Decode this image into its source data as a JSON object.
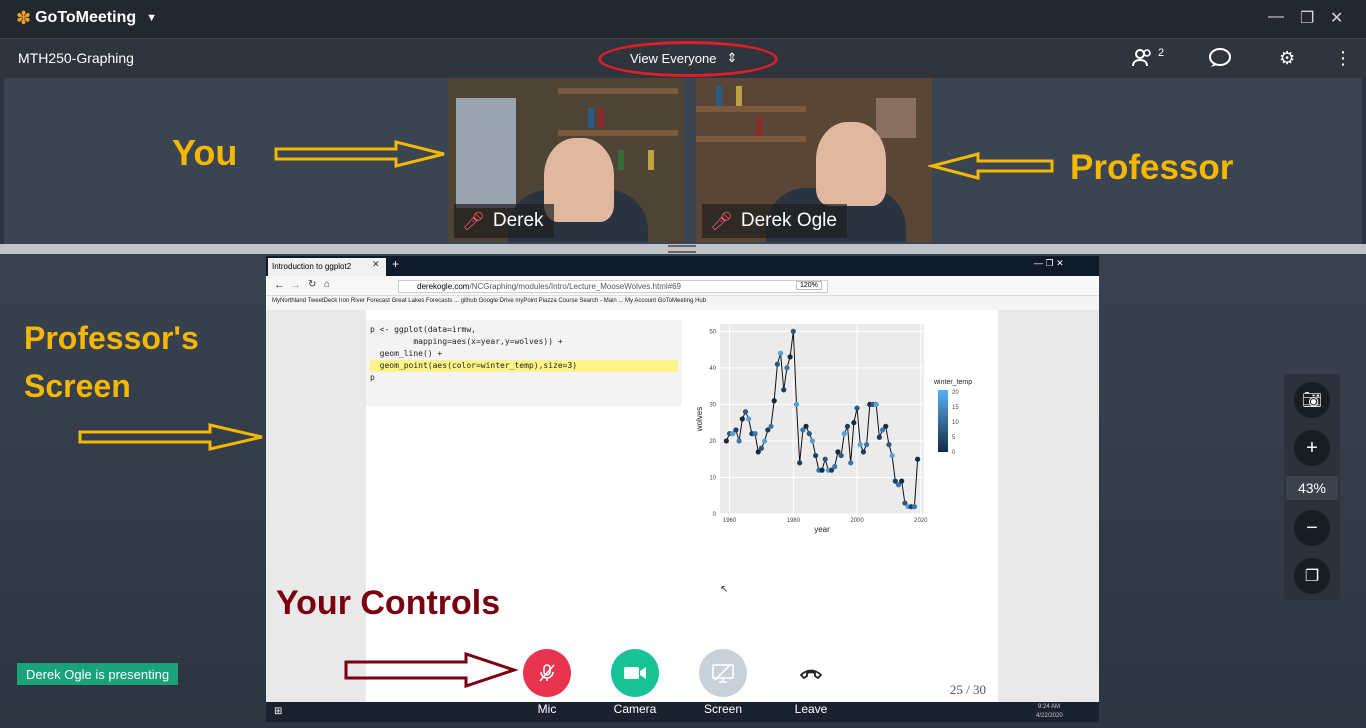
{
  "app": {
    "name": "GoToMeeting"
  },
  "window": {
    "minimize": "—",
    "restore": "❐",
    "close": "✕"
  },
  "toolbar": {
    "meeting_name": "MTH250-Graphing",
    "view_label": "View Everyone",
    "attendee_count": "2"
  },
  "participants": [
    {
      "name": "Derek",
      "annotation": "You"
    },
    {
      "name": "Derek Ogle",
      "annotation": "Professor"
    }
  ],
  "annotations": {
    "screen": "Professor's\nScreen",
    "screen_line1": "Professor's",
    "screen_line2": "Screen",
    "controls": "Your Controls"
  },
  "shared_screen": {
    "tab_title": "Introduction to ggplot2",
    "url_host": "derekogle.com",
    "url_path": "/NCGraphing/modules/Intro/Lecture_MooseWolves.html#69",
    "zoom": "120%",
    "bookmarks": "MyNorthland   TweetDeck   Iron River Forecast   Great Lakes Forecasts ...   github   Google Drive   myPoint   Piazza   Course Search - Main ...   My Account   GoToMeeting Hub",
    "code": [
      "p <- ggplot(data=irmw,",
      "         mapping=aes(x=year,y=wolves)) +",
      "  geom_line() +",
      "  geom_point(aes(color=winter_temp),size=3)",
      "",
      "p"
    ],
    "page": "25 / 30",
    "taskbar_time": "9:24 AM",
    "taskbar_date": "4/22/2020"
  },
  "chart_data": {
    "type": "line",
    "xlabel": "year",
    "ylabel": "wolves",
    "legend_title": "winter_temp",
    "legend_ticks": [
      "20",
      "15",
      "10",
      "5",
      "0"
    ],
    "xlim": [
      1957,
      2021
    ],
    "ylim": [
      0,
      52
    ],
    "x_ticks": [
      1960,
      1980,
      2000,
      2020
    ],
    "y_ticks": [
      0,
      10,
      20,
      30,
      40,
      50
    ],
    "grid": true,
    "x": [
      1959,
      1960,
      1961,
      1962,
      1963,
      1964,
      1965,
      1966,
      1967,
      1968,
      1969,
      1970,
      1971,
      1972,
      1973,
      1974,
      1975,
      1976,
      1977,
      1978,
      1979,
      1980,
      1981,
      1982,
      1983,
      1984,
      1985,
      1986,
      1987,
      1988,
      1989,
      1990,
      1991,
      1992,
      1993,
      1994,
      1995,
      1996,
      1997,
      1998,
      1999,
      2000,
      2001,
      2002,
      2003,
      2004,
      2005,
      2006,
      2007,
      2008,
      2009,
      2010,
      2011,
      2012,
      2013,
      2014,
      2015,
      2016,
      2017,
      2018,
      2019
    ],
    "y": [
      20,
      22,
      22,
      23,
      20,
      26,
      28,
      26,
      22,
      22,
      17,
      18,
      20,
      23,
      24,
      31,
      41,
      44,
      34,
      40,
      43,
      50,
      30,
      14,
      23,
      24,
      22,
      20,
      16,
      12,
      12,
      15,
      12,
      12,
      13,
      17,
      16,
      22,
      24,
      14,
      25,
      29,
      19,
      17,
      19,
      30,
      30,
      30,
      21,
      23,
      24,
      19,
      16,
      9,
      8,
      9,
      3,
      2,
      2,
      2,
      15
    ]
  },
  "controls": [
    {
      "label": "Mic",
      "color": "#e8344e"
    },
    {
      "label": "Camera",
      "color": "#19c395"
    },
    {
      "label": "Screen",
      "color": "#c8d0d8"
    },
    {
      "label": "Leave",
      "color": "#ffffff"
    }
  ],
  "zoom_panel": {
    "level": "43%"
  },
  "presenter_badge": "Derek Ogle is presenting",
  "colors": {
    "annotation_yellow": "#f5b800",
    "annotation_red": "#7a0010",
    "oval": "#e01d2a",
    "presenter": "#1aa37a"
  }
}
